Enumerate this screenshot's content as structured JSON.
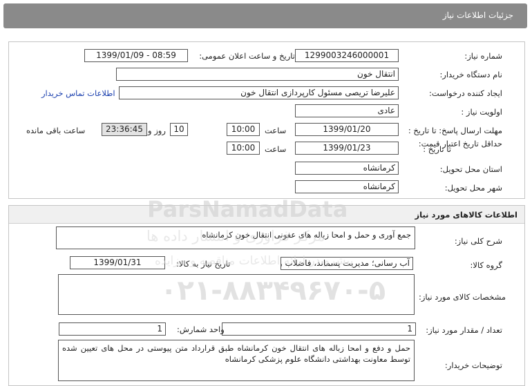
{
  "header": {
    "title": "جزئیات اطلاعات نیاز"
  },
  "details": {
    "need_number_label": "شماره نیاز:",
    "need_number": "1299003246000001",
    "announce_label": "تاریخ و ساعت اعلان عمومی:",
    "announce_value": "1399/01/09 - 08:59",
    "buyer_org_label": "نام دستگاه خریدار:",
    "buyer_org": "انتقال خون",
    "requester_label": "ایجاد کننده درخواست:",
    "requester": "علیرضا تریصی مسئول کارپردازی  انتقال خون",
    "contact_link": "اطلاعات تماس خریدار",
    "priority_label": "اولویت نیاز :",
    "priority": "عادی",
    "deadline_label": "مهلت ارسال پاسخ:  تا تاریخ :",
    "deadline_date": "1399/01/20",
    "time_label": "ساعت",
    "deadline_time": "10:00",
    "days_value": "10",
    "days_label": "روز و",
    "remaining_time": "23:36:45",
    "remaining_label": "ساعت باقی مانده",
    "validity_label": "حداقل تاریخ اعتبار قیمت:",
    "validity_to_label": "تا تاریخ :",
    "validity_date": "1399/01/23",
    "validity_time_label": "ساعت",
    "validity_time": "10:00",
    "province_label": "استان محل تحویل:",
    "province": "کرمانشاه",
    "city_label": "شهر محل تحویل:",
    "city": "کرمانشاه"
  },
  "goods": {
    "section_title": "اطلاعات کالاهای مورد نیاز",
    "summary_label": "شرح کلی نیاز:",
    "summary": "جمع آوری و حمل و امحا زباله های عفونی انتقال خون کرمانشاه",
    "group_label": "گروه کالا:",
    "group": "آب رسانی؛ مدیریت پسماند، فاضلاب و فعالیت ها",
    "need_date_label": "تاریخ نیاز به کالا:",
    "need_date": "1399/01/31",
    "specs_label": "مشخصات کالای مورد نیاز:",
    "specs": "",
    "qty_label": "تعداد / مقدار مورد نیاز:",
    "qty": "1",
    "unit_label": "واحد شمارش:",
    "unit": "1",
    "buyer_notes_label": "توضیحات خریدار:",
    "buyer_notes": "حمل و دفع و امحا زباله های انتقال خون کرمانشاه طبق قرارداد متن پیوستی در محل های تعیین شده توسط معاونت بهداشتی دانشگاه علوم پزشکی کرمانشاه"
  },
  "watermark": {
    "brand": "ParsNamadData",
    "tagline": "مرکز فراوری و انتشار داده ها",
    "tagline2": "پیشرو در ارائه اطلاعات مناقصه و مزایده",
    "phone": "۰۲۱-۸۸۳۴۹۶۷۰-۵"
  }
}
